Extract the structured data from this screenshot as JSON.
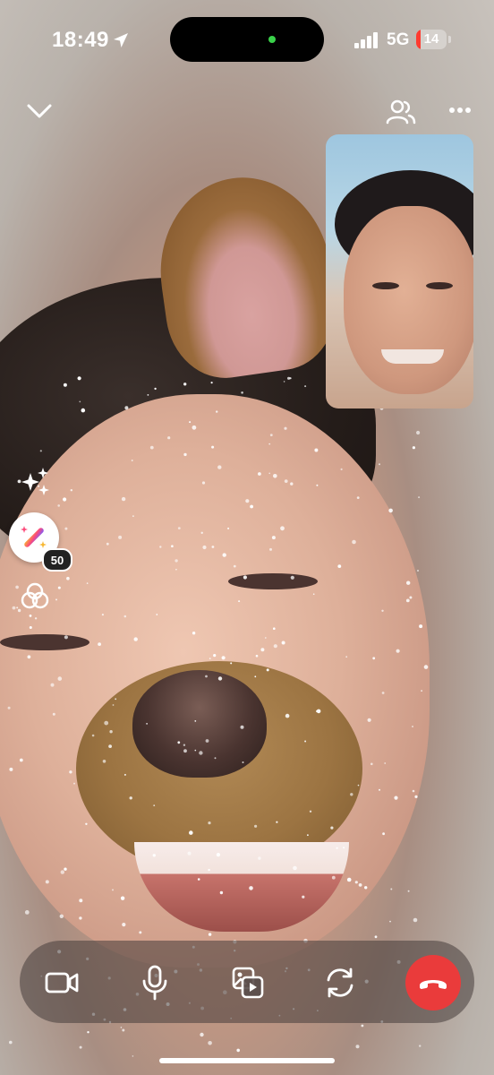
{
  "status_bar": {
    "time": "18:49",
    "network": "5G",
    "battery_level": "14",
    "battery_fraction": 0.14,
    "battery_color": "#ff3b30",
    "camera_indicator_color": "#3ad14a"
  },
  "top_controls": {
    "minimize_icon": "chevron-down-icon",
    "participants_icon": "people-icon",
    "more_icon": "more-horizontal-icon"
  },
  "effects": {
    "sparkle_icon": "sparkles-icon",
    "effect_icon": "magic-wand-icon",
    "effect_count": "50",
    "filter_icon": "filters-icon"
  },
  "call_controls": {
    "items": [
      "video-camera-icon",
      "microphone-icon",
      "media-share-icon",
      "flip-camera-icon",
      "end-call-icon"
    ],
    "end_call_color": "#ea3b3b"
  }
}
